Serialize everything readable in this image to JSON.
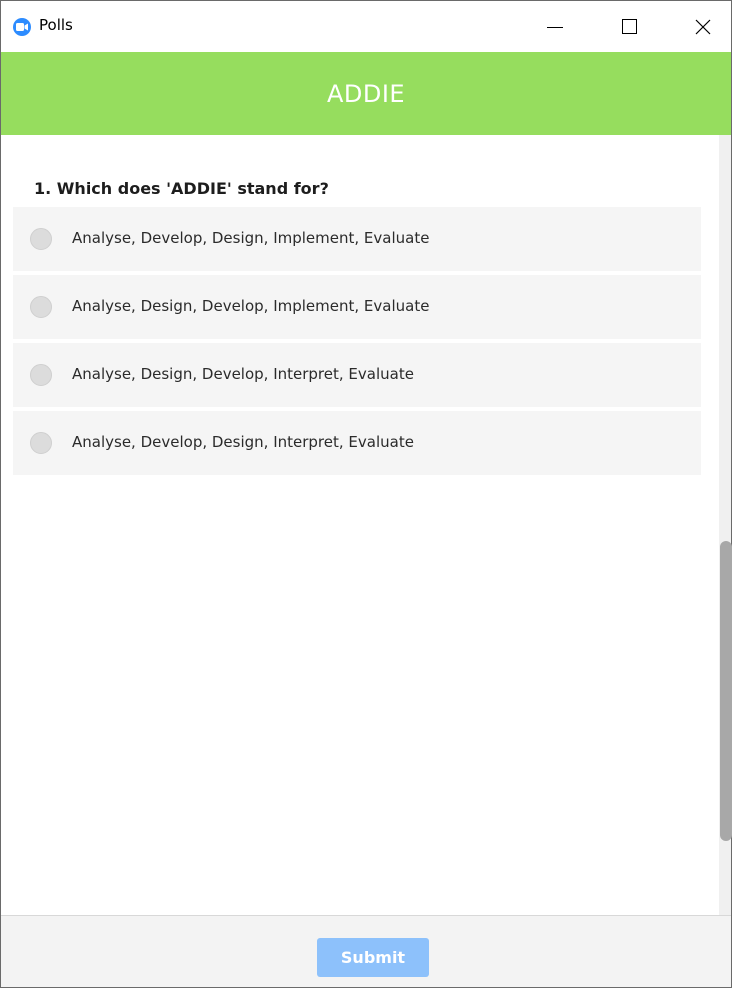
{
  "window": {
    "title": "Polls",
    "app_icon": "zoom-camera-icon",
    "controls": {
      "minimize_icon": "minimize-icon",
      "maximize_icon": "maximize-icon",
      "close_icon": "close-icon"
    }
  },
  "poll": {
    "title": "ADDIE",
    "header_color": "#96dd5e",
    "question": "1. Which does 'ADDIE' stand for?",
    "options": [
      {
        "label": "Analyse, Develop, Design, Implement, Evaluate",
        "selected": false
      },
      {
        "label": "Analyse, Design, Develop, Implement, Evaluate",
        "selected": false
      },
      {
        "label": "Analyse, Design, Develop, Interpret, Evaluate",
        "selected": false
      },
      {
        "label": "Analyse, Develop, Design, Interpret, Evaluate",
        "selected": false
      }
    ]
  },
  "footer": {
    "submit_label": "Submit",
    "submit_enabled": false,
    "submit_color": "#8dc1fb"
  }
}
